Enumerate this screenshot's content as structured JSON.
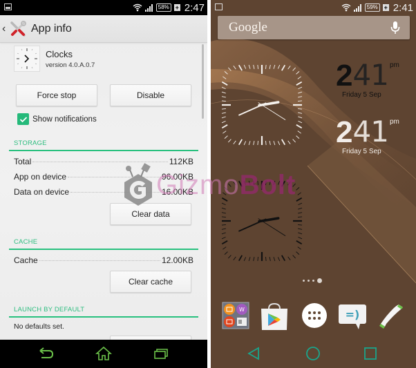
{
  "left_screen": {
    "status_bar": {
      "battery": "58%",
      "time": "2:47",
      "icons": [
        "image-notification-icon",
        "wifi-icon",
        "signal-icon",
        "battery-icon",
        "charging-icon"
      ]
    },
    "action_bar": {
      "title": "App info",
      "back_icon": "chevron-left-icon",
      "app_icon": "settings-tools-icon"
    },
    "app": {
      "name": "Clocks",
      "version": "version 4.0.A.0.7",
      "icon": "clock-app-icon"
    },
    "buttons": {
      "force_stop": "Force stop",
      "disable": "Disable",
      "clear_data": "Clear data",
      "clear_cache": "Clear cache"
    },
    "show_notifications": {
      "label": "Show notifications",
      "checked": true
    },
    "storage": {
      "header": "STORAGE",
      "rows": [
        {
          "label": "Total",
          "value": "112KB"
        },
        {
          "label": "App on device",
          "value": "96.00KB"
        },
        {
          "label": "Data on device",
          "value": "16.00KB"
        }
      ]
    },
    "cache": {
      "header": "CACHE",
      "rows": [
        {
          "label": "Cache",
          "value": "12.00KB"
        }
      ]
    },
    "launch_by_default": {
      "header": "LAUNCH BY DEFAULT",
      "text": "No defaults set."
    },
    "nav_bar": {
      "icons": [
        "back-icon",
        "home-icon",
        "recent-apps-icon"
      ],
      "color": "#6cc24a"
    }
  },
  "watermark": {
    "part1": "Gizmo",
    "part2": "Bolt"
  },
  "right_screen": {
    "status_bar": {
      "battery": "59%",
      "time": "2:41"
    },
    "search": {
      "label": "Google",
      "mic_icon": "microphone-icon"
    },
    "digital_clocks": [
      {
        "hour": "2",
        "minutes": "41",
        "ampm": "pm",
        "date": "Friday 5 Sep",
        "style": "dark"
      },
      {
        "hour": "2",
        "minutes": "41",
        "ampm": "pm",
        "date": "Friday 5 Sep",
        "style": "light"
      }
    ],
    "analog_clocks": [
      {
        "time": "2:41",
        "style": "white"
      },
      {
        "time": "2:41",
        "style": "black"
      }
    ],
    "page_indicator": {
      "pages": 4,
      "active_index": 3
    },
    "dock": [
      {
        "name": "Media folder",
        "icon": "folder-icon"
      },
      {
        "name": "Play Store",
        "icon": "play-store-icon"
      },
      {
        "name": "App drawer",
        "icon": "app-drawer-icon"
      },
      {
        "name": "Messaging",
        "icon": "messaging-icon"
      },
      {
        "name": "Phone",
        "icon": "phone-icon"
      }
    ],
    "nav_bar": {
      "icons": [
        "back-icon",
        "home-icon",
        "recent-apps-icon"
      ],
      "color": "#1aa58c"
    }
  },
  "colors": {
    "accent_green": "#28c07e",
    "wallpaper_brown": "#5e4431",
    "watermark_pink": "#cf78b4",
    "watermark_purple": "#96286e"
  }
}
